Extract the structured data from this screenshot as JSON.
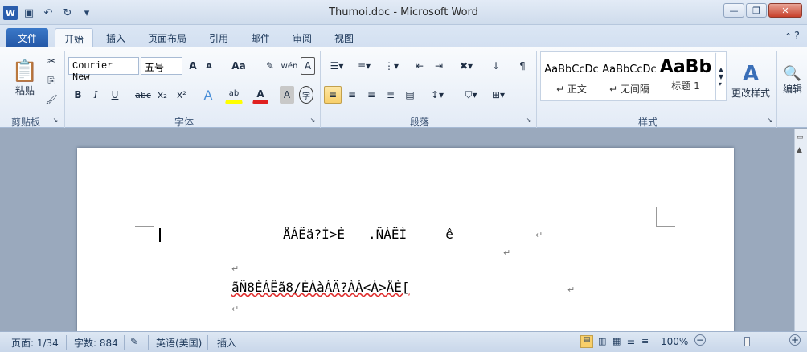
{
  "window": {
    "title": "Thumoi.doc - Microsoft Word"
  },
  "qat": {
    "app_icon": "W",
    "save": "save-icon",
    "undo": "undo-icon",
    "redo": "redo-icon",
    "customize": "customize-icon"
  },
  "tabs": [
    {
      "label": "文件"
    },
    {
      "label": "开始"
    },
    {
      "label": "插入"
    },
    {
      "label": "页面布局"
    },
    {
      "label": "引用"
    },
    {
      "label": "邮件"
    },
    {
      "label": "审阅"
    },
    {
      "label": "视图"
    }
  ],
  "clipboard": {
    "paste": "粘贴",
    "group": "剪贴板"
  },
  "font": {
    "name": "Courier New",
    "size": "五号",
    "group": "字体",
    "bold": "B",
    "italic": "I",
    "underline": "U",
    "strike": "abc",
    "sub": "x₂",
    "sup": "x²",
    "grow": "A",
    "shrink": "A",
    "case": "Aa",
    "char_a": "A",
    "char_border": "A",
    "circle": "字"
  },
  "paragraph": {
    "group": "段落"
  },
  "styles": {
    "group": "样式",
    "items": [
      {
        "sample": "AaBbCcDc",
        "name": "↵ 正文"
      },
      {
        "sample": "AaBbCcDc",
        "name": "↵ 无间隔"
      },
      {
        "sample": "AaBb",
        "name": "标题 1"
      }
    ],
    "change": "更改样式"
  },
  "editing": {
    "label": "编辑"
  },
  "document": {
    "line1": "ÅÁËä?Í>È   .ÑÀËÌ     ê",
    "line2": "ãÑ8ÈÁÊã8/ÈÁàÁÄ?ÀÁ<Á>ÅÈ[",
    "para_mark": "↵"
  },
  "status": {
    "page": "页面: 1/34",
    "words": "字数: 884",
    "lang": "英语(美国)",
    "mode": "插入",
    "zoom": "100%"
  }
}
